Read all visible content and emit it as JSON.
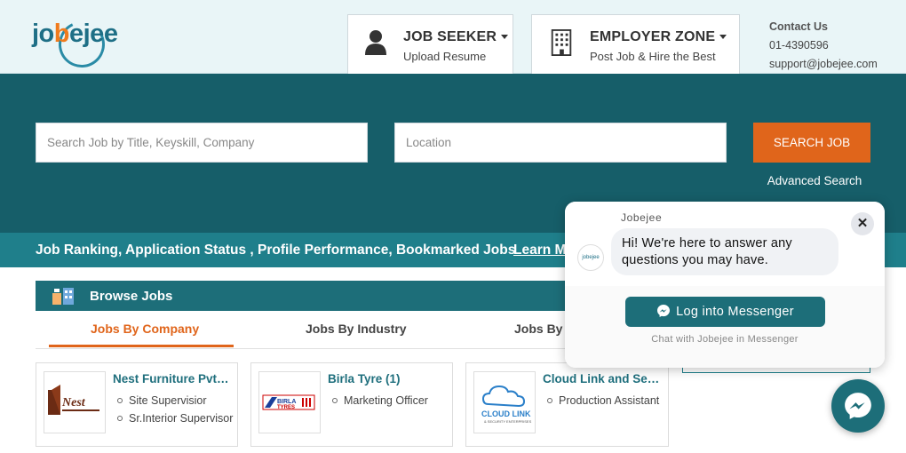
{
  "header": {
    "logo": {
      "part1": "jo",
      "part2": "b",
      "part3": "ejee"
    },
    "job_seeker": {
      "title": "JOB SEEKER",
      "subtitle": "Upload Resume"
    },
    "employer": {
      "title": "EMPLOYER ZONE",
      "subtitle": "Post Job & Hire the Best"
    },
    "contact": {
      "title": "Contact Us",
      "phone": "01-4390596",
      "email": "support@jobejee.com"
    }
  },
  "search": {
    "job_placeholder": "Search Job by Title, Keyskill, Company",
    "location_placeholder": "Location",
    "button_label": "SEARCH JOB",
    "advanced_label": "Advanced Search"
  },
  "ranking": {
    "text": "Job Ranking, Application Status , Profile Performance, Bookmarked Jobs",
    "learn_more": "Learn M"
  },
  "browse": {
    "title": "Browse Jobs",
    "tabs": [
      "Jobs By Company",
      "Jobs By Industry",
      "Jobs By L"
    ]
  },
  "companies": [
    {
      "name": "Nest Furniture Pvt. ...",
      "logo_text": "Nest",
      "jobs": [
        "Site Supervisior",
        "Sr.Interior Supervisor"
      ]
    },
    {
      "name": "Birla Tyre (1)",
      "logo_text": "BIRLA TYRES",
      "jobs": [
        "Marketing Officer"
      ]
    },
    {
      "name": "Cloud Link and Sec...",
      "logo_text": "CLOUD LINK",
      "jobs": [
        "Production Assistant"
      ]
    }
  ],
  "chat": {
    "name": "Jobejee",
    "message": "Hi! We're here to answer any questions you may have.",
    "close": "✕",
    "avatar_text": "jobejee",
    "button_label": "Log into Messenger",
    "footer": "Chat with Jobejee in Messenger"
  },
  "colors": {
    "primary": "#165e69",
    "accent": "#e0651b",
    "band": "#1f7f8b"
  }
}
